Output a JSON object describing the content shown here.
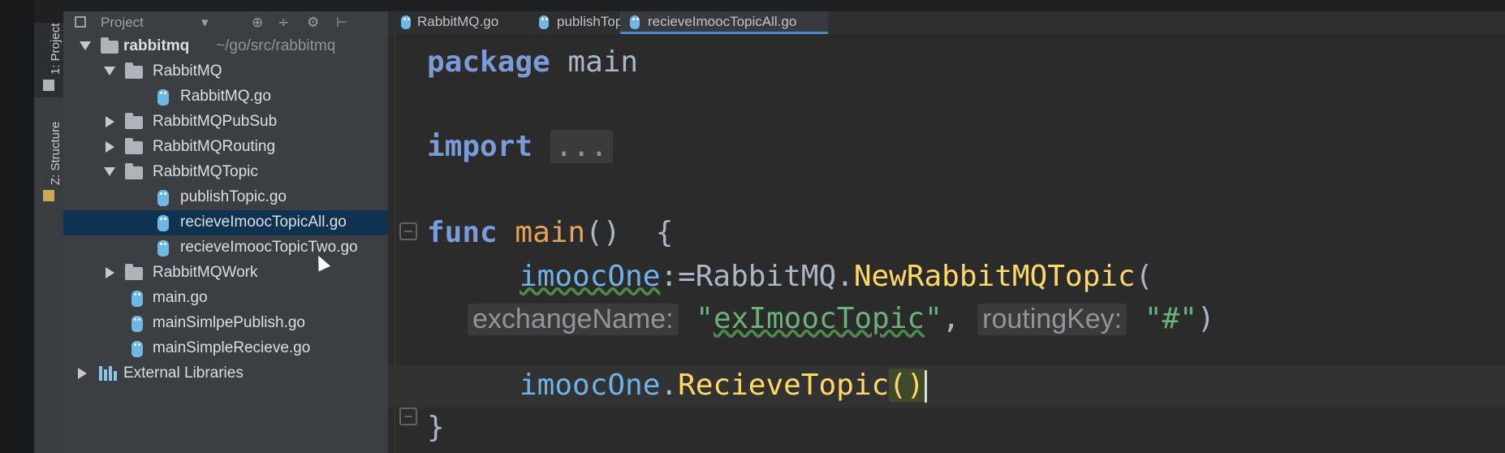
{
  "colors": {
    "accent": "#4a88c7",
    "selection": "#0e3250",
    "keyword": "#7a9bd8",
    "function": "#e7a25a",
    "string": "#6ab27a"
  },
  "tool_strip": {
    "project_tab": "1: Project",
    "structure_tab": "Z: Structure"
  },
  "project_header": {
    "label": "Project",
    "dropdown_icon": "▾",
    "icons": [
      "⊕",
      "÷",
      "⚙",
      "⊢"
    ]
  },
  "tree": {
    "root_name": "rabbitmq",
    "root_path": "~/go/src/rabbitmq",
    "items": [
      {
        "label": "RabbitMQ"
      },
      {
        "label": "RabbitMQ.go"
      },
      {
        "label": "RabbitMQPubSub"
      },
      {
        "label": "RabbitMQRouting"
      },
      {
        "label": "RabbitMQTopic"
      },
      {
        "label": "publishTopic.go"
      },
      {
        "label": "recieveImoocTopicAll.go"
      },
      {
        "label": "recieveImoocTopicTwo.go"
      },
      {
        "label": "RabbitMQWork"
      },
      {
        "label": "main.go"
      },
      {
        "label": "mainSimlpePublish.go"
      },
      {
        "label": "mainSimpleRecieve.go"
      },
      {
        "label": "External Libraries"
      }
    ]
  },
  "tabs": [
    {
      "label": "RabbitMQ.go"
    },
    {
      "label": "publishTopic.go"
    },
    {
      "label": "recieveImoocTopicAll.go"
    }
  ],
  "code": {
    "kw_package": "package",
    "pkg_name": "main",
    "kw_import": "import",
    "import_fold": "...",
    "kw_func": "func",
    "func_name": "main",
    "func_sig": "()  {",
    "var_name": "imoocOne",
    "assign": ":=RabbitMQ.",
    "ctor": "NewRabbitMQTopic",
    "open_paren": "(",
    "hint_exchange": "exchangeName:",
    "arg_exchange_q1": "\"",
    "arg_exchange_word": "exImoocTopic",
    "arg_exchange_q2": "\"",
    "comma": ",",
    "hint_routing": "routingKey:",
    "arg_routing": "\"#\"",
    "close_paren": ")",
    "dot": ".",
    "method": "RecieveTopic",
    "call_parens": "()",
    "close_brace": "}"
  }
}
